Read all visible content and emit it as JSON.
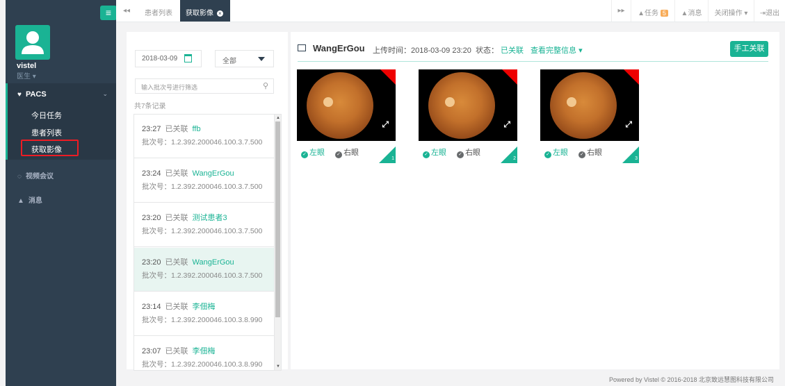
{
  "sidebar": {
    "toggle_icon": "hamburger-icon",
    "user": {
      "name": "vistel",
      "role": "医生"
    },
    "pacs": {
      "label": "PACS",
      "items": [
        "今日任务",
        "患者列表",
        "获取影像"
      ]
    },
    "video_conference": "视频会议",
    "messages": "消息"
  },
  "topbar": {
    "tabs": {
      "patients": "患者列表",
      "active": "获取影像"
    },
    "tasks": "任务",
    "task_count": "5",
    "messages": "消息",
    "close_ops": "关闭操作",
    "logout": "退出"
  },
  "list": {
    "date": "2018-03-09",
    "status": "全部",
    "filter_placeholder": "输入批次号进行筛选",
    "count": "共7条记录",
    "batch_prefix": "批次号：",
    "records": [
      {
        "time": "23:27",
        "status": "已关联",
        "name": "ffb",
        "batch": "1.2.392.200046.100.3.7.500"
      },
      {
        "time": "23:24",
        "status": "已关联",
        "name": "WangErGou",
        "batch": "1.2.392.200046.100.3.7.500"
      },
      {
        "time": "23:20",
        "status": "已关联",
        "name": "测试患者3",
        "batch": "1.2.392.200046.100.3.7.500"
      },
      {
        "time": "23:20",
        "status": "已关联",
        "name": "WangErGou",
        "batch": "1.2.392.200046.100.3.7.500"
      },
      {
        "time": "23:14",
        "status": "已关联",
        "name": "李佃梅",
        "batch": "1.2.392.200046.100.3.8.990"
      },
      {
        "time": "23:07",
        "status": "已关联",
        "name": "李佃梅",
        "batch": "1.2.392.200046.100.3.8.990"
      }
    ],
    "selected_index": 3
  },
  "detail": {
    "patient_name": "WangErGou",
    "upload_label": "上传时间：2018-03-09 23:20",
    "state_label": "状态：",
    "state_value": "已关联",
    "more_info": "查看完整信息",
    "manual_button": "手工关联",
    "images": [
      {
        "left": "左眼",
        "right": "右眼",
        "index": "1"
      },
      {
        "left": "左眼",
        "right": "右眼",
        "index": "2"
      },
      {
        "left": "左眼",
        "right": "右眼",
        "index": "3"
      }
    ]
  },
  "footer": "Powered by Vistel © 2016-2018 北京致远慧图科技有限公司",
  "colors": {
    "accent": "#1ab394",
    "sidebar": "#2f4050",
    "highlight_border": "#ed1c24"
  }
}
